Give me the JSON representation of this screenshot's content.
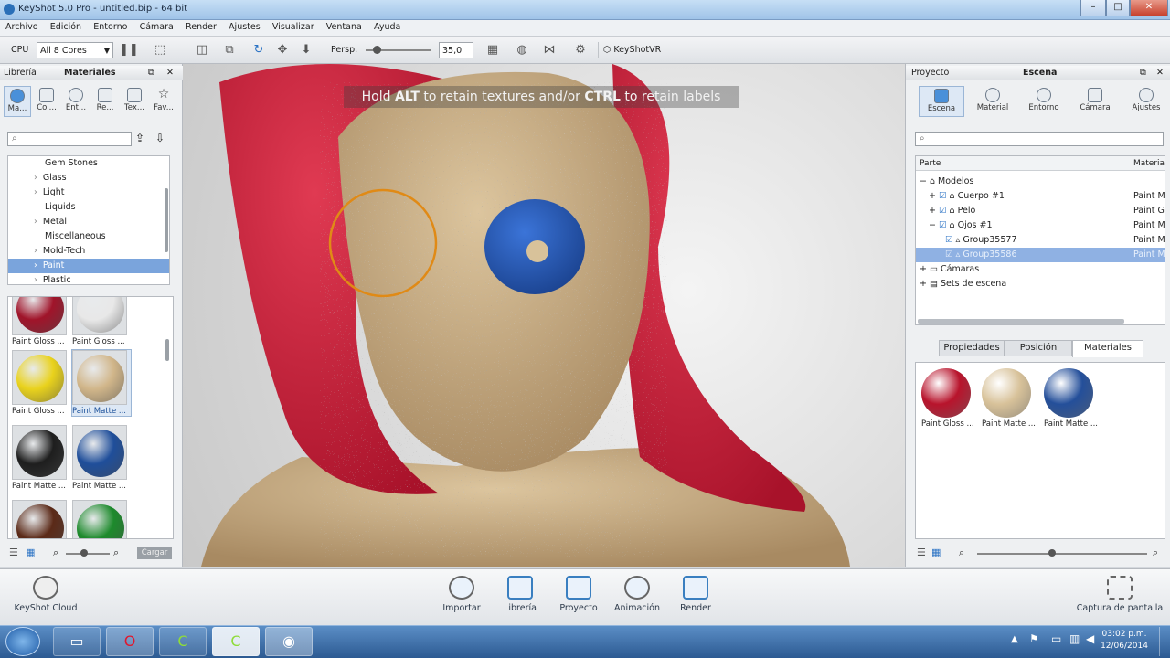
{
  "window": {
    "title": "KeyShot 5.0 Pro - untitled.bip - 64 bit",
    "minimize": "–",
    "maximize": "□",
    "close": "✕"
  },
  "menu": [
    "Archivo",
    "Edición",
    "Entorno",
    "Cámara",
    "Render",
    "Ajustes",
    "Visualizar",
    "Ventana",
    "Ayuda"
  ],
  "toolbar": {
    "cpu_label": "CPU",
    "cpu_value": "All 8 Cores",
    "persp_label": "Persp.",
    "persp_value": "35,0",
    "vr_label": "KeyShotVR"
  },
  "left_panel": {
    "tab_libreria": "Librería",
    "tab_materiales": "Materiales",
    "icon_tabs": [
      "Ma...",
      "Col...",
      "Ent...",
      "Re...",
      "Tex...",
      "Fav..."
    ],
    "search_placeholder": "",
    "tree": [
      "Gem Stones",
      "Glass",
      "Light",
      "Liquids",
      "Metal",
      "Miscellaneous",
      "Mold-Tech",
      "Paint",
      "Plastic"
    ],
    "thumbs": [
      {
        "label": "Paint Gloss ...",
        "color": "#a0142a"
      },
      {
        "label": "Paint Gloss ...",
        "color": "#e8e8e8"
      },
      {
        "label": "Paint Gloss ...",
        "color": "#e9d21c"
      },
      {
        "label": "Paint Matte ...",
        "color": "#d1b68a"
      },
      {
        "label": "Paint Matte ...",
        "color": "#1e1e1e"
      },
      {
        "label": "Paint Matte ...",
        "color": "#1f4e9a"
      },
      {
        "label": "",
        "color": "#5b2a18"
      },
      {
        "label": "",
        "color": "#1d8a2c"
      }
    ],
    "load_button": "Cargar"
  },
  "viewport": {
    "hint_pre": "Hold ",
    "hint_alt": "ALT",
    "hint_mid": " to retain textures and/or ",
    "hint_ctrl": "CTRL",
    "hint_post": " to retain labels"
  },
  "right_panel": {
    "tab_proyecto": "Proyecto",
    "tab_escena": "Escena",
    "icon_tabs": [
      "Escena",
      "Material",
      "Entorno",
      "Cámara",
      "Ajustes"
    ],
    "col_parte": "Parte",
    "col_material": "Materia",
    "tree": [
      {
        "label": "Modelos",
        "mat": ""
      },
      {
        "label": "Cuerpo #1",
        "mat": "Paint M"
      },
      {
        "label": "Pelo",
        "mat": "Paint Gl"
      },
      {
        "label": "Ojos #1",
        "mat": "Paint M"
      },
      {
        "label": "Group35577",
        "mat": "Paint M"
      },
      {
        "label": "Group35586",
        "mat": "Paint M"
      },
      {
        "label": "Cámaras",
        "mat": ""
      },
      {
        "label": "Sets de escena",
        "mat": ""
      }
    ],
    "subtabs": [
      "Propiedades",
      "Posición",
      "Materiales"
    ],
    "materials": [
      {
        "label": "Paint Gloss ...",
        "color": "#b8142c"
      },
      {
        "label": "Paint Matte ...",
        "color": "#d8c29a"
      },
      {
        "label": "Paint Matte ...",
        "color": "#244f9a"
      }
    ]
  },
  "bottom_bar": {
    "cloud": "KeyShot Cloud",
    "buttons": [
      "Importar",
      "Librería",
      "Proyecto",
      "Animación",
      "Render"
    ],
    "capture": "Captura de pantalla"
  },
  "taskbar": {
    "time": "03:02 p.m.",
    "date": "12/06/2014"
  }
}
